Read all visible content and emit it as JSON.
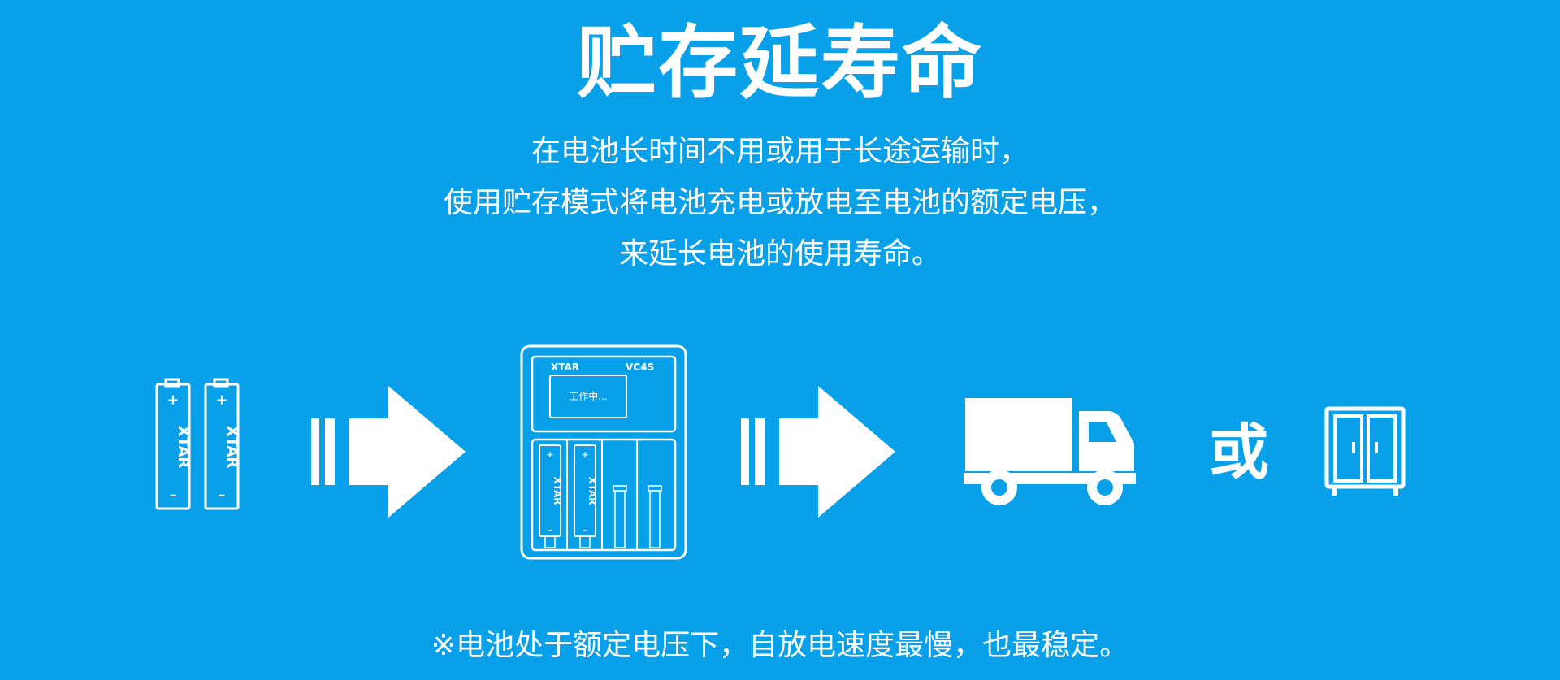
{
  "title": "贮存延寿命",
  "description": [
    "在电池长时间不用或用于长途运输时，",
    "使用贮存模式将电池充电或放电至电池的额定电压，",
    "来延长电池的使用寿命。"
  ],
  "battery": {
    "brand": "XTAR",
    "plus": "+",
    "minus": "–"
  },
  "charger": {
    "brand": "XTAR",
    "model": "VC4S",
    "status": "工作中..."
  },
  "or_label": "或",
  "footnote": "※电池处于额定电压下，自放电速度最慢，也最稳定。",
  "icons": [
    "battery-icon",
    "arrow-right-icon",
    "charger-icon",
    "truck-icon",
    "cabinet-icon"
  ],
  "colors": {
    "background": "#07a0e9",
    "foreground": "#ffffff"
  }
}
